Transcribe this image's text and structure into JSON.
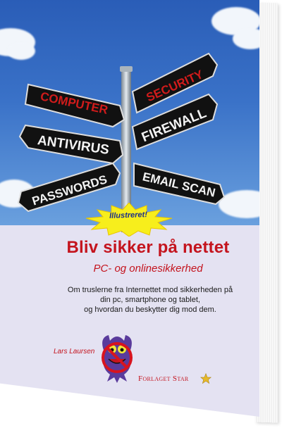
{
  "cover": {
    "signs": [
      "COMPUTER",
      "SECURITY",
      "ANTIVIRUS",
      "FIREWALL",
      "PASSWORDS",
      "EMAIL SCAN"
    ],
    "badge": "Illustreret!",
    "title": "Bliv sikker på nettet",
    "subtitle": "PC- og onlinesikkerhed",
    "description": [
      "Om truslerne fra Internettet mod sikkerheden på",
      "din pc, smartphone og tablet,",
      "og hvordan du beskytter dig mod dem."
    ],
    "author": "Lars Laursen",
    "publisher": "Forlaget Star"
  },
  "colors": {
    "title_red": "#c4141e",
    "sky_blue": "#2a5db7",
    "lower_panel": "#e4e2f2",
    "sign_black": "#111111",
    "badge_yellow": "#f7ee1c"
  }
}
